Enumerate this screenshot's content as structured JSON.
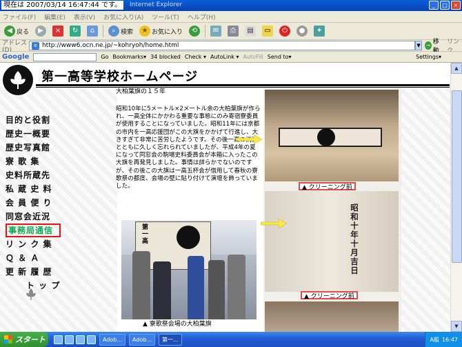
{
  "window": {
    "stamp": "現在は 2007/03/14 16:47:44 です。",
    "app_title": "Internet Explorer",
    "controls": [
      "_",
      "□",
      "×"
    ]
  },
  "menu": [
    "ファイル(F)",
    "編集(E)",
    "表示(V)",
    "お気に入り(A)",
    "ツール(T)",
    "ヘルプ(H)"
  ],
  "toolbar": {
    "back": "戻る",
    "search": "検索",
    "favorites": "お気に入り"
  },
  "address": {
    "label": "アドレス(D)",
    "url": "http://www6.ocn.ne.jp/~kohryoh/home.html",
    "go": "移動",
    "links": "リンク"
  },
  "google_bar": {
    "logo": "Google",
    "go": "Go",
    "bookmarks": "Bookmarks▾",
    "blocked": "34 blocked",
    "check": "Check ▾",
    "autolink": "AutoLink ▾",
    "autofill": "AutoFill",
    "send_to": "Send to▾",
    "settings": "Settings▾"
  },
  "page": {
    "title": "第一高等学校ホームページ",
    "nav": [
      "目的と役割",
      "歴史一概要",
      "歴史写真館",
      "寮 歌 集",
      "史料所蔵先",
      "私 蔵 史 料",
      "会 員 便 り",
      "同窓会近況",
      "事務局通信",
      "リ ン ク 集",
      "Ｑ ＆ Ａ",
      "更 新 履 歴",
      "ト ッ プ"
    ],
    "active_nav_index": 8,
    "subtitle": "大柏葉旗の１５年",
    "body": "昭和10年に5メートル×2メートル余の大柏葉旗が作られ、一高全体にかかわる重要な事態にのみ寄宿寮委員が使用することになっていました。昭和11年には京都の市内を一高応援団がこの大旗をかかげて行進し、大きすぎて非常に苦労したようです。その後一高の消滅とともに久しく忘れられていましたが、平成4年の夏になって同窓会の駒場史料委員会が本箱に入ったこの大旗を再発見しました。事情は詳らかでないのですが、その後この大旗は一高五杯会が借用して春秋の寮歌祭の都度、会場の壁に貼り付けて演壇を飾っていました。",
    "caption_cleaning_1": "▲ クリーニング前",
    "caption_cleaning_2": "▲ クリーニング前",
    "caption_photo": "▲ 寮歌祭会場の大柏葉旗",
    "flag_inscription": "昭和十年十月吉日",
    "banner_text": "第一高"
  },
  "taskbar": {
    "start": "スタート",
    "buttons": [
      "Adob...",
      "Adob...",
      "第一..."
    ],
    "clock": "16:47",
    "ime": "A般"
  },
  "colors": {
    "titlebar": "#0a5fd8",
    "active_nav_border": "#e11111",
    "active_nav_text": "#11aa55",
    "caption_border": "#e34b4b",
    "arrow": "#f5e84a"
  }
}
